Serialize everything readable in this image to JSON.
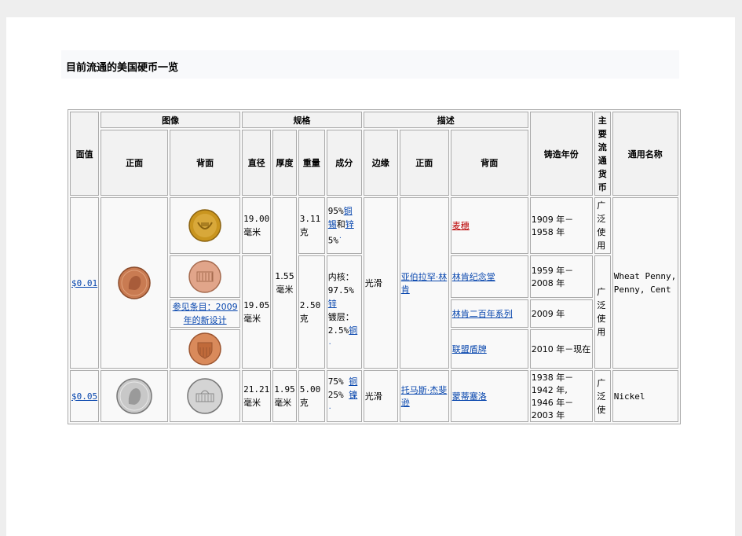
{
  "title": "目前流通的美国硬币一览",
  "headers": {
    "face_value": "面值",
    "image": "图像",
    "spec": "规格",
    "desc": "描述",
    "obverse": "正面",
    "reverse": "背面",
    "diameter": "直径",
    "thickness": "厚度",
    "mass": "重量",
    "composition": "成分",
    "edge": "边缘",
    "desc_obverse": "正面",
    "desc_reverse": "背面",
    "years": "铸造年份",
    "circulation": "主要流通货币",
    "common_name": "通用名称"
  },
  "penny": {
    "value": "$0.01",
    "see_also": "参见条目：2009年的新设计",
    "diameter_a": "19.00毫米",
    "diameter_b": "19.05毫米",
    "thickness": "1.55毫米",
    "mass_a": "3.11克",
    "mass_b": "2.50克",
    "comp_a_pre": "95%",
    "comp_a_copper": "铜",
    "comp_a_tin": "锡",
    "comp_a_and": "和",
    "comp_a_zinc": "锌",
    "comp_a_post": "5%",
    "comp_b_core": "内核：97.5%",
    "comp_b_zinc": "锌",
    "comp_b_plate": "镀层：2.5%",
    "comp_b_copper": "铜",
    "edge": "光滑",
    "obverse_desc": "亚伯拉罕·林肯",
    "reverses": [
      {
        "label": "麦穗",
        "years": "1909 年－1958 年"
      },
      {
        "label": "林肯纪念堂",
        "years": "1959 年－2008 年"
      },
      {
        "label": "林肯二百年系列",
        "years": "2009 年"
      },
      {
        "label": "联盟盾牌",
        "years": "2010 年－现在"
      }
    ],
    "circ_a": "广泛使用",
    "circ_b": "广泛使用",
    "common_name": "Wheat Penny, Penny, Cent"
  },
  "nickel": {
    "value": "$0.05",
    "diameter": "21.21毫米",
    "thickness": "1.95毫米",
    "mass": "5.00克",
    "comp_pre": "75%",
    "comp_copper": "铜",
    "comp_mid": "25%",
    "comp_nickel": "镍",
    "edge": "光滑",
    "obverse_desc": "托马斯·杰斐逊",
    "reverse_desc": "蒙蒂塞洛",
    "years": "1938 年－1942 年, 1946 年－2003 年",
    "circulation": "广泛使",
    "common_name": "Nickel"
  },
  "colors": {
    "link": "#0645ad",
    "redlink": "#ba0000",
    "gold": "#c9951f",
    "copper": "#c97b52",
    "silver": "#c8c8c8"
  },
  "icons": {
    "penny_obverse": "lincoln-cent-obverse-icon",
    "wheat_reverse": "wheat-cent-reverse-icon",
    "memorial_reverse": "lincoln-memorial-reverse-icon",
    "shield_reverse": "union-shield-reverse-icon",
    "nickel_obverse": "jefferson-nickel-obverse-icon",
    "nickel_reverse": "monticello-reverse-icon"
  }
}
